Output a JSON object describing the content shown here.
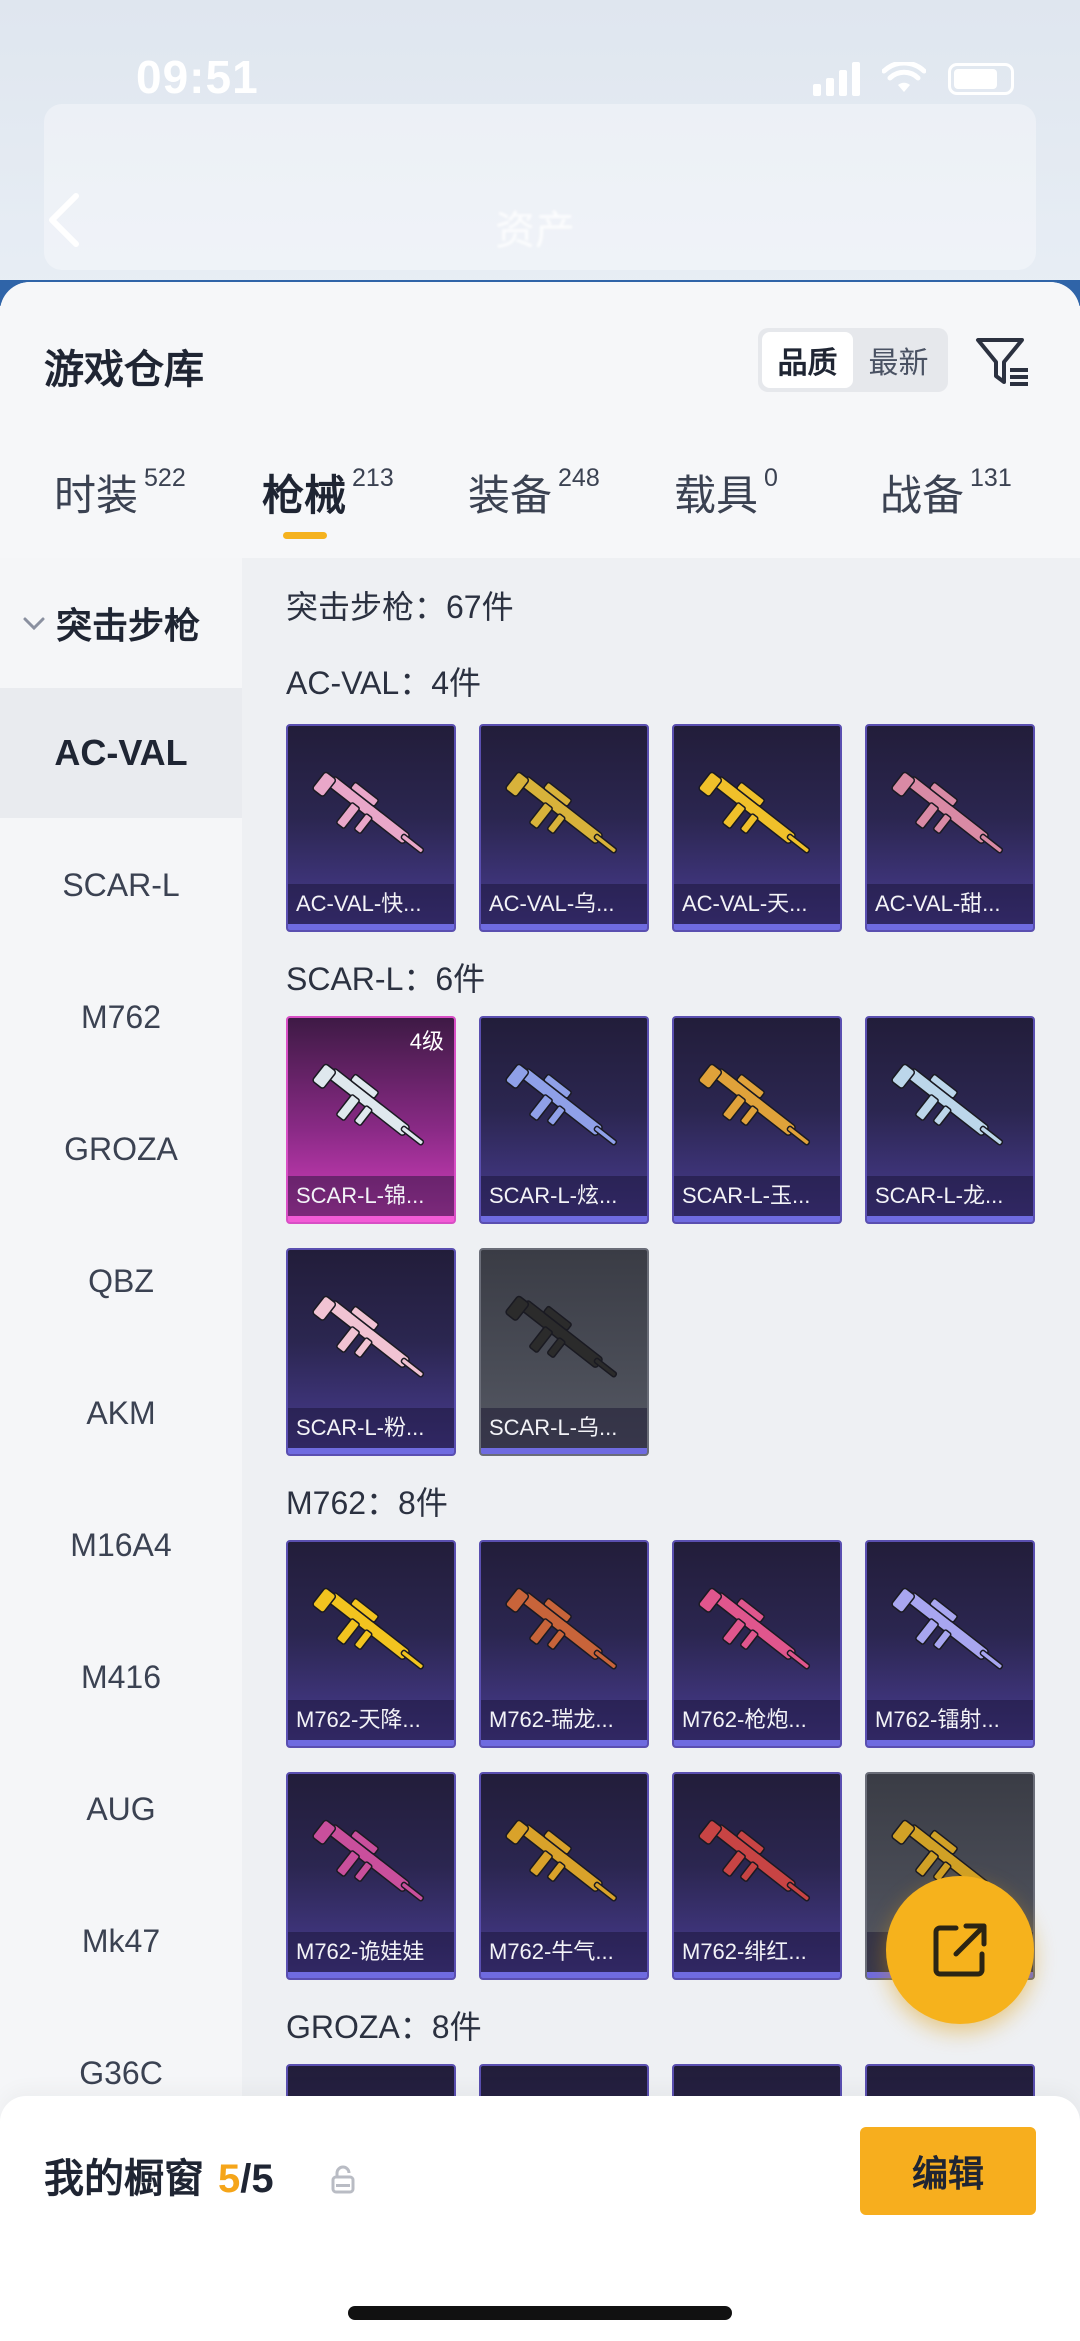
{
  "status": {
    "time": "09:51"
  },
  "header_bg": {
    "title": "资产"
  },
  "warehouse": {
    "title": "游戏仓库",
    "sort": {
      "options": [
        "品质",
        "最新"
      ],
      "selected": "品质"
    },
    "tabs": [
      {
        "label": "时装",
        "count": "522"
      },
      {
        "label": "枪械",
        "count": "213",
        "active": true
      },
      {
        "label": "装备",
        "count": "248"
      },
      {
        "label": "载具",
        "count": "0"
      },
      {
        "label": "战备",
        "count": "131"
      }
    ]
  },
  "sidebar": {
    "category": "突击步枪",
    "items": [
      "AC-VAL",
      "SCAR-L",
      "M762",
      "GROZA",
      "QBZ",
      "AKM",
      "M16A4",
      "M416",
      "AUG",
      "Mk47",
      "G36C"
    ],
    "active": "AC-VAL"
  },
  "content": {
    "summary": "突击步枪：67件",
    "sections": [
      {
        "title": "AC-VAL：4件",
        "items": [
          {
            "label": "AC-VAL-快...",
            "color": "#e9a7c9"
          },
          {
            "label": "AC-VAL-乌...",
            "color": "#d8b23a"
          },
          {
            "label": "AC-VAL-天...",
            "color": "#f0c02a"
          },
          {
            "label": "AC-VAL-甜...",
            "color": "#d98aa5"
          }
        ]
      },
      {
        "title": "SCAR-L：6件",
        "items": [
          {
            "label": "SCAR-L-锦...",
            "level": "4级",
            "color": "#dfe8ee"
          },
          {
            "label": "SCAR-L-炫...",
            "color": "#8fa0e8"
          },
          {
            "label": "SCAR-L-玉...",
            "color": "#e0a23a"
          },
          {
            "label": "SCAR-L-龙...",
            "color": "#bcd6ea"
          },
          {
            "label": "SCAR-L-粉...",
            "color": "#f1c3d3"
          },
          {
            "label": "SCAR-L-乌...",
            "color": "#2b2b2b"
          }
        ]
      },
      {
        "title": "M762：8件",
        "items": [
          {
            "label": "M762-天降...",
            "color": "#f2c41f"
          },
          {
            "label": "M762-瑞龙...",
            "color": "#c8643a"
          },
          {
            "label": "M762-枪炮...",
            "color": "#e0568d"
          },
          {
            "label": "M762-镭射...",
            "color": "#a8a6f0"
          },
          {
            "label": "M762-诡娃娃",
            "color": "#c94f9c"
          },
          {
            "label": "M762-牛气...",
            "color": "#d9a22a"
          },
          {
            "label": "M762-绯红...",
            "color": "#c84444"
          },
          {
            "label": "",
            "color": "#d1a126"
          }
        ]
      },
      {
        "title": "GROZA：8件",
        "items": []
      }
    ]
  },
  "showcase": {
    "title": "我的橱窗",
    "count": "5",
    "total": "/5",
    "edit_label": "编辑"
  },
  "colors": {
    "accent": "#f5b21e",
    "card_purple": "#4a3d94",
    "card_pink": "#d63fbf"
  }
}
